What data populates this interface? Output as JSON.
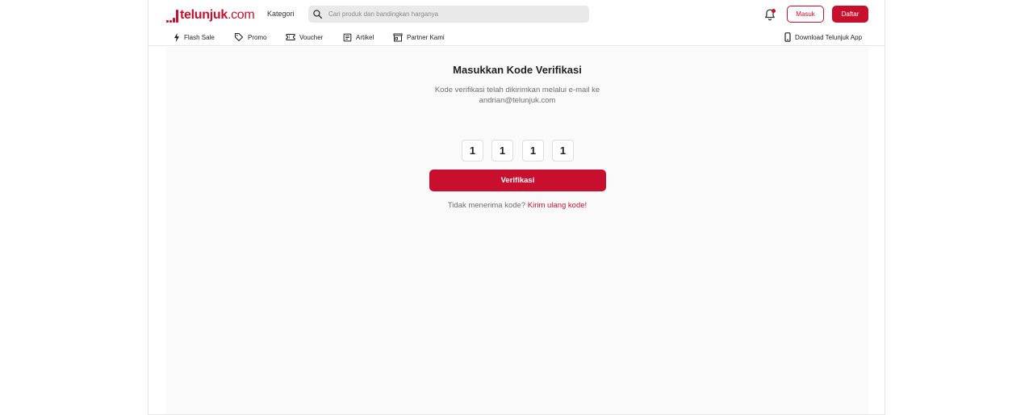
{
  "header": {
    "logo": {
      "brand": "telunjuk",
      "domain": ".com"
    },
    "kategori_label": "Kategori",
    "search": {
      "placeholder": "Cari produk dan bandingkan harganya",
      "value": ""
    },
    "notification_icon": "bell-icon",
    "login_label": "Masuk",
    "register_label": "Daftar"
  },
  "nav": {
    "items": [
      {
        "label": "Flash Sale",
        "icon": "lightning-icon"
      },
      {
        "label": "Promo",
        "icon": "tag-icon"
      },
      {
        "label": "Voucher",
        "icon": "ticket-icon"
      },
      {
        "label": "Artikel",
        "icon": "article-icon"
      },
      {
        "label": "Partner Kami",
        "icon": "store-icon"
      }
    ],
    "download_label": "Download Telunjuk App",
    "download_icon": "phone-icon"
  },
  "verification": {
    "title": "Masukkan Kode Verifikasi",
    "description_line1": "Kode verifikasi telah dikirimkan melalui e-mail ke",
    "email": "andrian@telunjuk.com",
    "otp_digits": [
      "1",
      "1",
      "1",
      "1"
    ],
    "submit_label": "Verifikasi",
    "resend_prompt": "Tidak menerima kode?",
    "resend_link": "Kirim ulang kode!"
  },
  "colors": {
    "brand": "#c8102e",
    "content_background": "#fafafa",
    "search_background": "#e9e9e9"
  }
}
